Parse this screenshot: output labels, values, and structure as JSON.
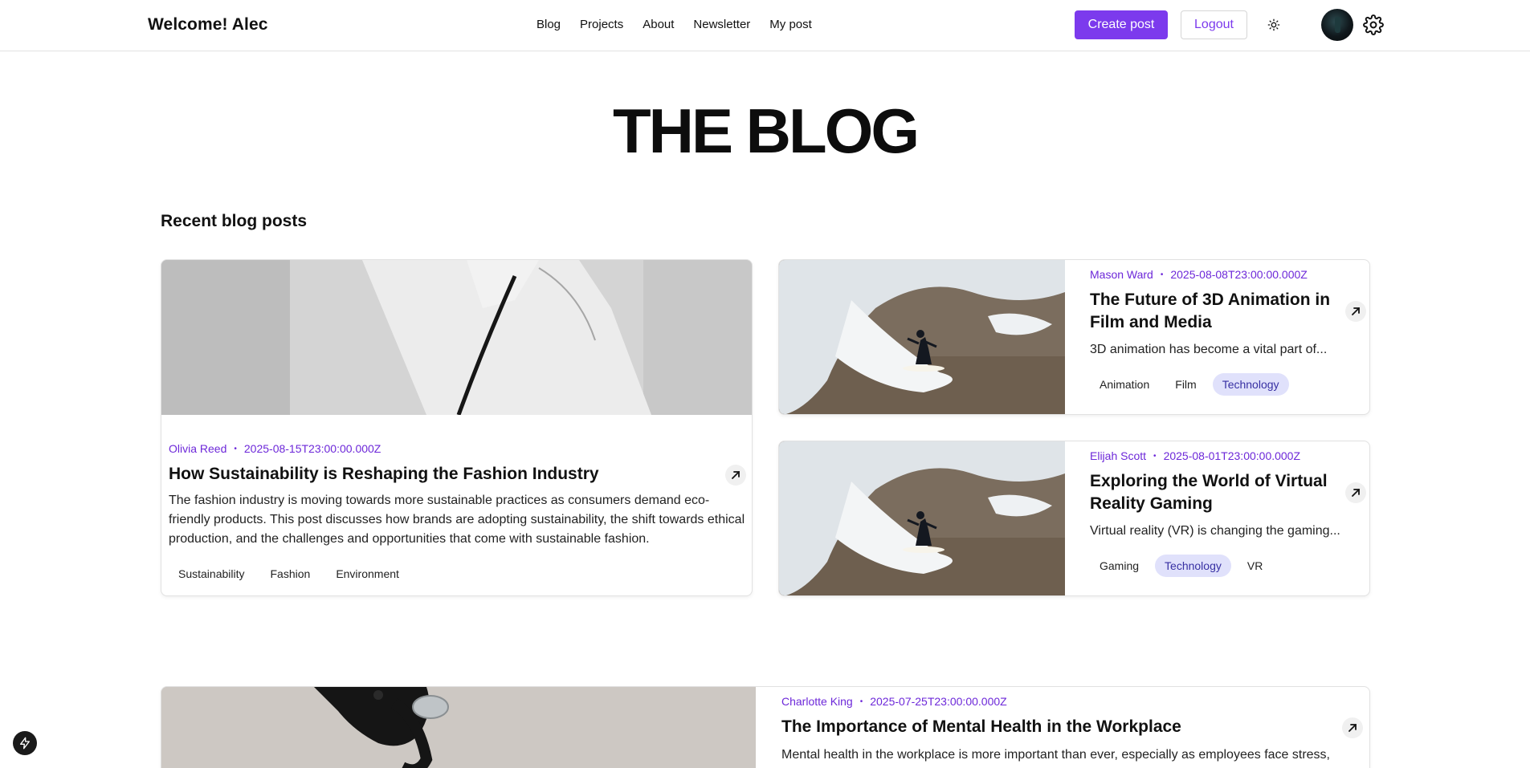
{
  "header": {
    "brand": "Welcome! Alec",
    "nav": [
      "Blog",
      "Projects",
      "About",
      "Newsletter",
      "My post"
    ],
    "create_label": "Create post",
    "logout_label": "Logout"
  },
  "hero": {
    "title": "THE BLOG"
  },
  "section": {
    "title": "Recent blog posts"
  },
  "posts": [
    {
      "author": "Olivia Reed",
      "date": "2025-08-15T23:00:00.000Z",
      "title": "How Sustainability is Reshaping the Fashion Industry",
      "excerpt": "The fashion industry is moving towards more sustainable practices as consumers demand eco-friendly products. This post discusses how brands are adopting sustainability, the shift towards ethical production, and the challenges and opportunities that come with sustainable fashion.",
      "tags": [
        "Sustainability",
        "Fashion",
        "Environment"
      ]
    },
    {
      "author": "Mason Ward",
      "date": "2025-08-08T23:00:00.000Z",
      "title": "The Future of 3D Animation in Film and Media",
      "excerpt": "3D animation has become a vital part of...",
      "tags": [
        "Animation",
        "Film",
        "Technology"
      ]
    },
    {
      "author": "Elijah Scott",
      "date": "2025-08-01T23:00:00.000Z",
      "title": "Exploring the World of Virtual Reality Gaming",
      "excerpt": "Virtual reality (VR) is changing the gaming...",
      "tags": [
        "Gaming",
        "Technology",
        "VR"
      ]
    },
    {
      "author": "Charlotte King",
      "date": "2025-07-25T23:00:00.000Z",
      "title": "The Importance of Mental Health in the Workplace",
      "excerpt": "Mental health in the workplace is more important than ever, especially as employees face stress,"
    }
  ],
  "colors": {
    "accent": "#7c3aed",
    "tag_highlight_bg": "#e0e1fb"
  }
}
